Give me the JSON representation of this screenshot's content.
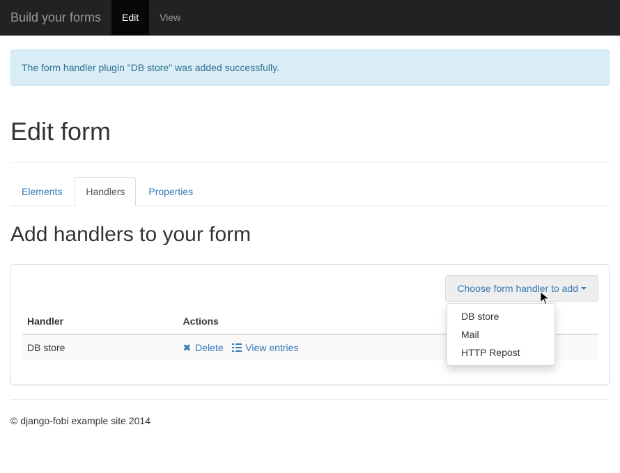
{
  "navbar": {
    "brand": "Build your forms",
    "items": [
      {
        "label": "Edit",
        "active": true
      },
      {
        "label": "View",
        "active": false
      }
    ]
  },
  "alert": {
    "message": "The form handler plugin \"DB store\" was added successfully."
  },
  "page_title": "Edit form",
  "tabs": [
    {
      "label": "Elements",
      "active": false
    },
    {
      "label": "Handlers",
      "active": true
    },
    {
      "label": "Properties",
      "active": false
    }
  ],
  "section_title": "Add handlers to your form",
  "dropdown": {
    "label": "Choose form handler to add",
    "options": [
      "DB store",
      "Mail",
      "HTTP Repost"
    ]
  },
  "table": {
    "headers": {
      "handler": "Handler",
      "actions": "Actions"
    },
    "rows": [
      {
        "handler": "DB store",
        "actions": {
          "delete": "Delete",
          "view_entries": "View entries"
        }
      }
    ]
  },
  "footer": "© django-fobi example site 2014"
}
